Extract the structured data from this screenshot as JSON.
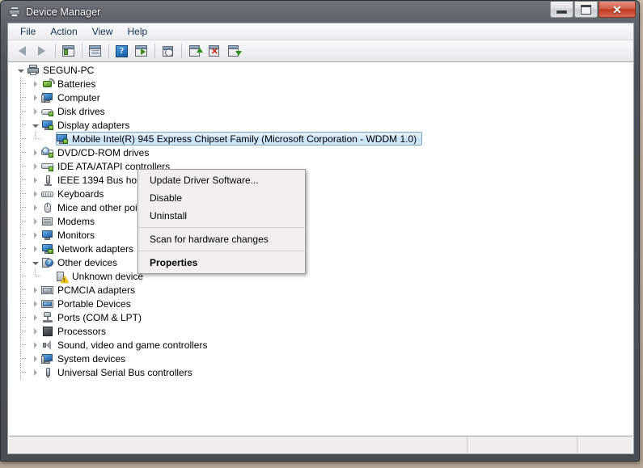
{
  "window": {
    "title": "Device Manager",
    "title_icon": "device-manager-icon",
    "caption": {
      "minimize": "Minimize",
      "maximize": "Maximize",
      "close": "Close",
      "close_glyph": "✕"
    }
  },
  "menubar": {
    "items": [
      {
        "label": "File",
        "name": "menu-file"
      },
      {
        "label": "Action",
        "name": "menu-action"
      },
      {
        "label": "View",
        "name": "menu-view"
      },
      {
        "label": "Help",
        "name": "menu-help"
      }
    ]
  },
  "toolbar": {
    "buttons": [
      {
        "name": "back-arrow-icon",
        "type": "back",
        "tooltip": "Back"
      },
      {
        "name": "forward-arrow-icon",
        "type": "forward",
        "tooltip": "Forward"
      },
      {
        "name": "separator-1",
        "type": "sep"
      },
      {
        "name": "show-tree-icon",
        "type": "tree",
        "tooltip": "Show/hide console tree"
      },
      {
        "name": "separator-2",
        "type": "sep"
      },
      {
        "name": "properties-icon",
        "type": "props",
        "tooltip": "Properties"
      },
      {
        "name": "separator-3",
        "type": "sep"
      },
      {
        "name": "help-icon",
        "type": "help",
        "tooltip": "Help"
      },
      {
        "name": "show-details-icon",
        "type": "details",
        "tooltip": "Show details"
      },
      {
        "name": "separator-4",
        "type": "sep"
      },
      {
        "name": "scan-hardware-icon",
        "type": "scan",
        "tooltip": "Scan for hardware changes"
      },
      {
        "name": "separator-5",
        "type": "sep"
      },
      {
        "name": "update-driver-icon",
        "type": "update",
        "tooltip": "Update Driver Software"
      },
      {
        "name": "disable-device-icon",
        "type": "disable",
        "tooltip": "Disable"
      },
      {
        "name": "uninstall-device-icon",
        "type": "uninstall",
        "tooltip": "Uninstall"
      }
    ]
  },
  "tree": {
    "nodes": [
      {
        "label": "SEGUN-PC",
        "level": 0,
        "state": "expanded",
        "icon": "computer-root-icon",
        "selected": false
      },
      {
        "label": "Batteries",
        "level": 1,
        "state": "collapsed",
        "icon": "battery-icon",
        "selected": false
      },
      {
        "label": "Computer",
        "level": 1,
        "state": "collapsed",
        "icon": "computer-icon",
        "selected": false
      },
      {
        "label": "Disk drives",
        "level": 1,
        "state": "collapsed",
        "icon": "disk-drive-icon",
        "selected": false
      },
      {
        "label": "Display adapters",
        "level": 1,
        "state": "expanded",
        "icon": "display-adapter-icon",
        "selected": false
      },
      {
        "label": "Mobile Intel(R) 945 Express Chipset Family (Microsoft Corporation - WDDM 1.0)",
        "level": 2,
        "state": "leaf",
        "icon": "display-adapter-icon",
        "selected": true
      },
      {
        "label": "DVD/CD-ROM drives",
        "level": 1,
        "state": "collapsed",
        "icon": "dvd-drive-icon",
        "selected": false
      },
      {
        "label": "IDE ATA/ATAPI controllers",
        "level": 1,
        "state": "collapsed",
        "icon": "ide-controller-icon",
        "selected": false
      },
      {
        "label": "IEEE 1394 Bus host controllers",
        "level": 1,
        "state": "collapsed",
        "icon": "ieee1394-icon",
        "selected": false
      },
      {
        "label": "Keyboards",
        "level": 1,
        "state": "collapsed",
        "icon": "keyboard-icon",
        "selected": false
      },
      {
        "label": "Mice and other pointing devices",
        "level": 1,
        "state": "collapsed",
        "icon": "mouse-icon",
        "selected": false
      },
      {
        "label": "Modems",
        "level": 1,
        "state": "collapsed",
        "icon": "modem-icon",
        "selected": false
      },
      {
        "label": "Monitors",
        "level": 1,
        "state": "collapsed",
        "icon": "monitor-icon",
        "selected": false
      },
      {
        "label": "Network adapters",
        "level": 1,
        "state": "collapsed",
        "icon": "network-adapter-icon",
        "selected": false
      },
      {
        "label": "Other devices",
        "level": 1,
        "state": "expanded",
        "icon": "other-devices-icon",
        "selected": false
      },
      {
        "label": "Unknown device",
        "level": 2,
        "state": "leaf",
        "icon": "unknown-device-warning-icon",
        "selected": false
      },
      {
        "label": "PCMCIA adapters",
        "level": 1,
        "state": "collapsed",
        "icon": "pcmcia-adapter-icon",
        "selected": false
      },
      {
        "label": "Portable Devices",
        "level": 1,
        "state": "collapsed",
        "icon": "portable-device-icon",
        "selected": false
      },
      {
        "label": "Ports (COM & LPT)",
        "level": 1,
        "state": "collapsed",
        "icon": "port-icon",
        "selected": false
      },
      {
        "label": "Processors",
        "level": 1,
        "state": "collapsed",
        "icon": "processor-icon",
        "selected": false
      },
      {
        "label": "Sound, video and game controllers",
        "level": 1,
        "state": "collapsed",
        "icon": "sound-controller-icon",
        "selected": false
      },
      {
        "label": "System devices",
        "level": 1,
        "state": "collapsed",
        "icon": "system-device-icon",
        "selected": false
      },
      {
        "label": "Universal Serial Bus controllers",
        "level": 1,
        "state": "collapsed",
        "icon": "usb-controller-icon",
        "selected": false
      }
    ]
  },
  "context_menu": {
    "items": [
      {
        "label": "Update Driver Software...",
        "name": "ctx-update-driver-software",
        "bold": false,
        "type": "item"
      },
      {
        "label": "Disable",
        "name": "ctx-disable",
        "bold": false,
        "type": "item"
      },
      {
        "label": "Uninstall",
        "name": "ctx-uninstall",
        "bold": false,
        "type": "item"
      },
      {
        "label": "",
        "name": "ctx-separator-1",
        "bold": false,
        "type": "sep"
      },
      {
        "label": "Scan for hardware changes",
        "name": "ctx-scan-for-hardware-changes",
        "bold": false,
        "type": "item"
      },
      {
        "label": "",
        "name": "ctx-separator-2",
        "bold": false,
        "type": "sep"
      },
      {
        "label": "Properties",
        "name": "ctx-properties",
        "bold": true,
        "type": "item"
      }
    ]
  },
  "statusbar": {
    "pane_main": "",
    "pane_two": "",
    "pane_three": ""
  },
  "colors": {
    "selection_border": "#7da2ce",
    "selection_fill": "#c3dffa",
    "menu_text": "#16314f",
    "close_button": "#bf3a22",
    "warning_yellow": "#f2c700"
  }
}
